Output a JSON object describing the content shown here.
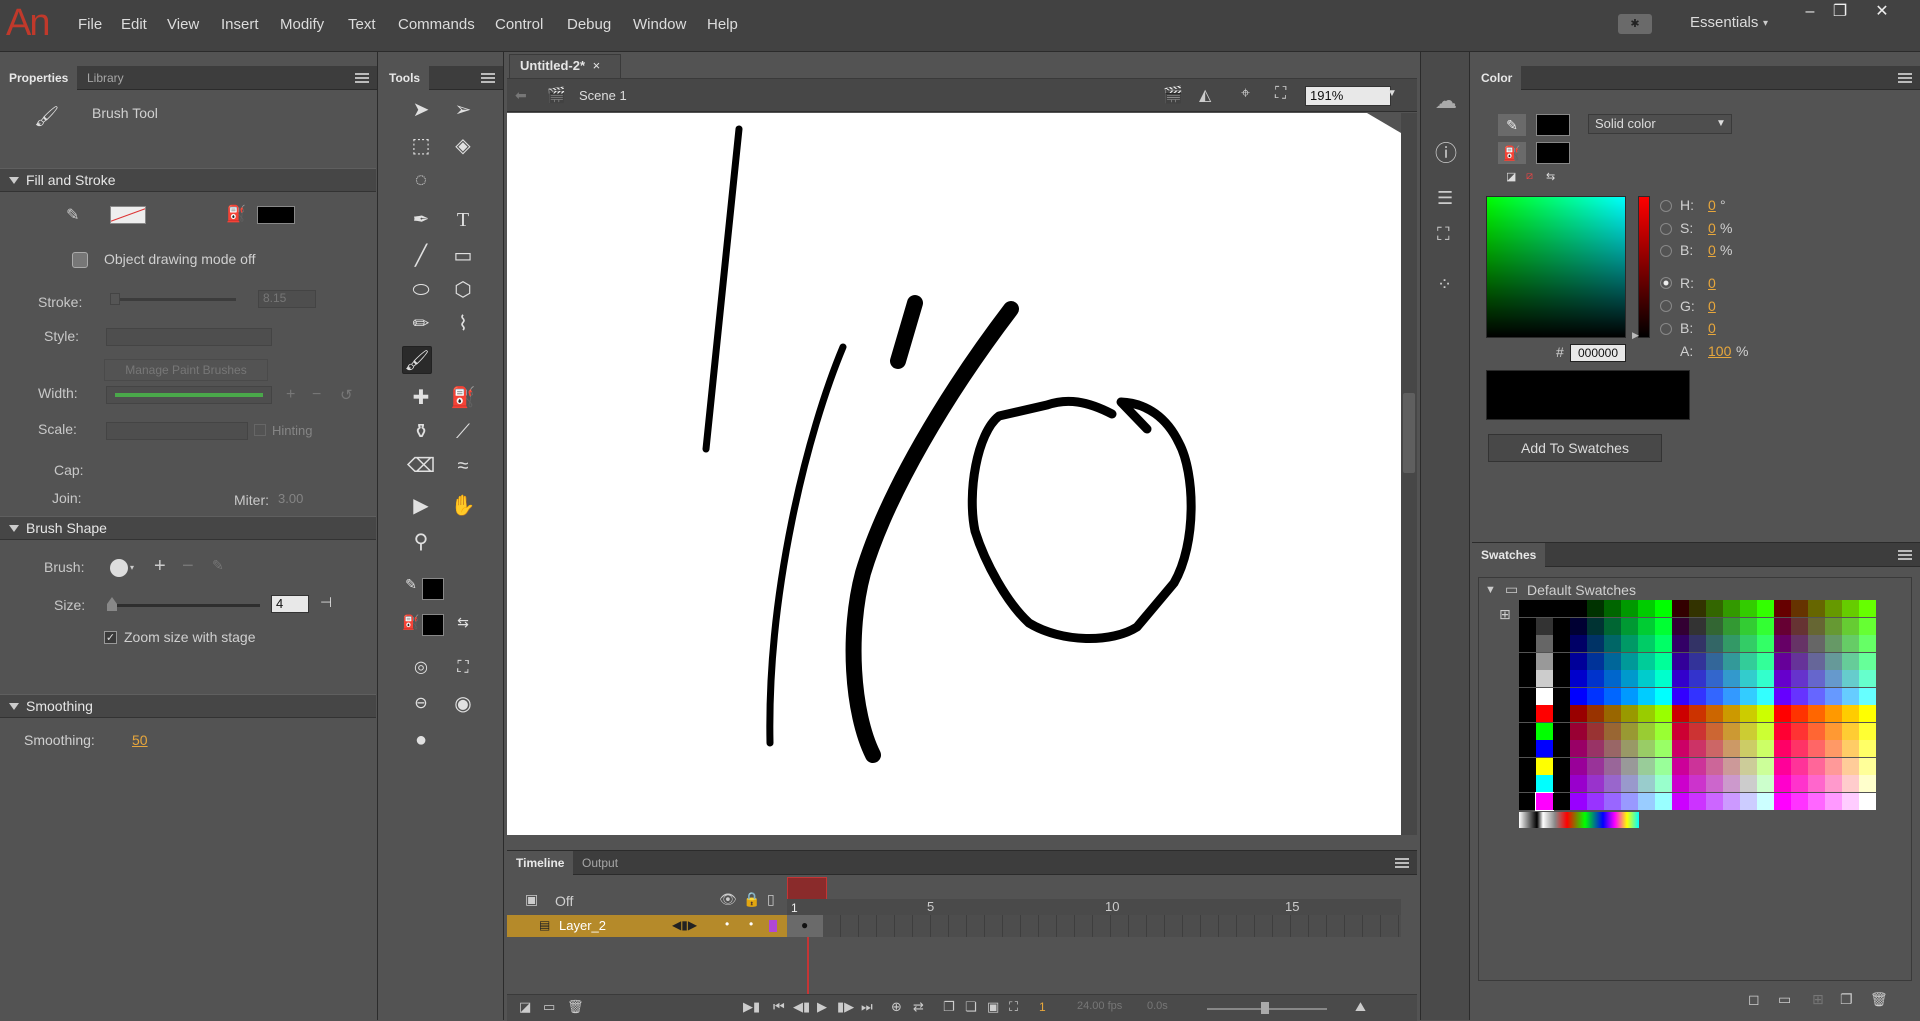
{
  "app": {
    "logo": "An"
  },
  "menu": [
    "File",
    "Edit",
    "View",
    "Insert",
    "Modify",
    "Text",
    "Commands",
    "Control",
    "Debug",
    "Window",
    "Help"
  ],
  "workspace": {
    "label": "Essentials"
  },
  "props": {
    "tabs": [
      "Properties",
      "Library"
    ],
    "tool_name": "Brush Tool",
    "sections": {
      "fill_stroke": "Fill and Stroke",
      "brush_shape": "Brush Shape",
      "smoothing": "Smoothing"
    },
    "object_mode": "Object drawing mode off",
    "stroke_label": "Stroke:",
    "stroke_value": "8.15",
    "style_label": "Style:",
    "manage_brushes": "Manage Paint Brushes",
    "width_label": "Width:",
    "scale_label": "Scale:",
    "hinting": "Hinting",
    "cap_label": "Cap:",
    "join_label": "Join:",
    "miter_label": "Miter:",
    "miter_value": "3.00",
    "brush_label": "Brush:",
    "size_label": "Size:",
    "size_value": "4",
    "zoom_size": "Zoom size with stage",
    "smoothing_label": "Smoothing:",
    "smoothing_value": "50"
  },
  "tools": {
    "title": "Tools"
  },
  "doc": {
    "tab": "Untitled-2*",
    "scene": "Scene 1",
    "zoom": "191%"
  },
  "color": {
    "title": "Color",
    "fill_type": "Solid color",
    "h_label": "H:",
    "h": "0",
    "h_unit": "°",
    "s_label": "S:",
    "s": "0",
    "s_unit": "%",
    "b_label": "B:",
    "b": "0",
    "b_unit": "%",
    "r_label": "R:",
    "r": "0",
    "g_label": "G:",
    "g": "0",
    "bl_label": "B:",
    "bl": "0",
    "a_label": "A:",
    "a": "100",
    "a_unit": "%",
    "hash": "#",
    "hex": "000000",
    "add_swatches": "Add To Swatches"
  },
  "swatches": {
    "title": "Swatches",
    "folder": "Default Swatches"
  },
  "timeline": {
    "tabs": [
      "Timeline",
      "Output"
    ],
    "off_label": "Off",
    "layer": "Layer_2",
    "frames": [
      "1",
      "5",
      "10",
      "15"
    ],
    "current_frame": "1",
    "fps": "24.00 fps",
    "time": "0.0s"
  }
}
